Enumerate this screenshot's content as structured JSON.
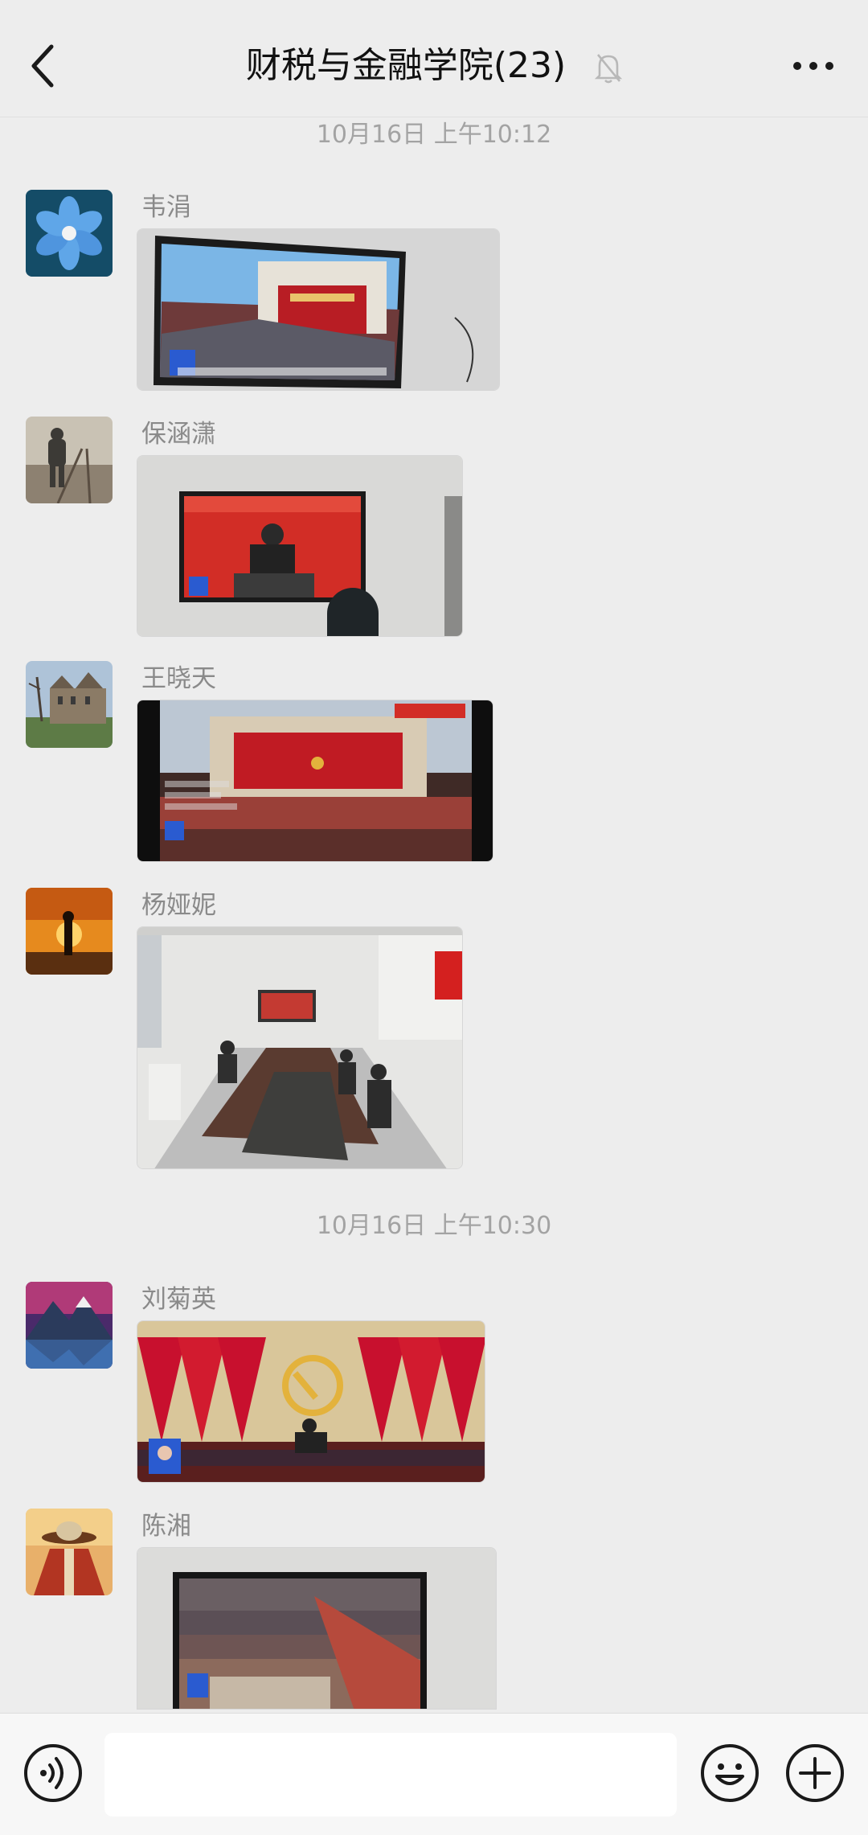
{
  "header": {
    "title": "财税与金融学院(23)",
    "back_icon": "chevron-left-icon",
    "mute_icon": "bell-off-icon",
    "more_icon": "more-horizontal-icon"
  },
  "timestamps": [
    "10月16日 上午10:12",
    "10月16日 上午10:30"
  ],
  "messages": [
    {
      "sender": "韦涓",
      "avatar": "blue-flower-avatar",
      "photo": "tv-showing-great-hall-assembly"
    },
    {
      "sender": "保涵潇",
      "avatar": "person-on-railway-avatar",
      "photo": "tv-showing-speaker-at-podium"
    },
    {
      "sender": "王晓天",
      "avatar": "castle-building-avatar",
      "photo": "livestream-screen-assembly-hall"
    },
    {
      "sender": "杨娅妮",
      "avatar": "sunset-silhouette-avatar",
      "photo": "meeting-room-watching-broadcast"
    },
    {
      "sender": "刘菊英",
      "avatar": "mountain-lake-avatar",
      "photo": "stage-with-party-emblem-and-flags"
    },
    {
      "sender": "陈湘",
      "avatar": "cartoon-character-avatar",
      "photo": "tv-showing-delegates-seated"
    }
  ],
  "input_bar": {
    "voice_icon": "voice-icon",
    "emoji_icon": "emoji-icon",
    "plus_icon": "plus-circle-icon",
    "input_placeholder": ""
  },
  "colors": {
    "background": "#ededed",
    "party_red": "#c8102e",
    "gold": "#e3b23c"
  }
}
